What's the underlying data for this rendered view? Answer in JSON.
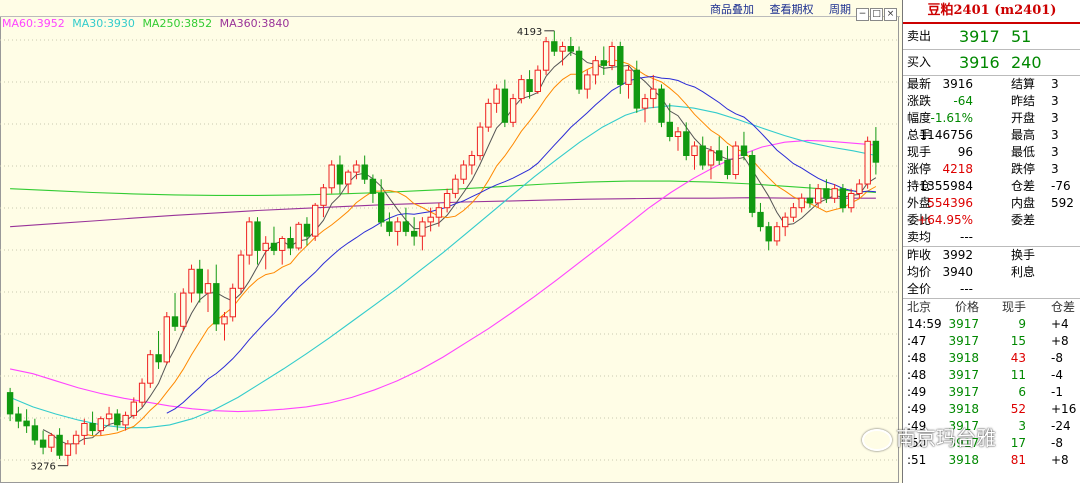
{
  "legend": [
    {
      "label": "MA60:3952",
      "color": "#ff44ff"
    },
    {
      "label": "MA30:3930",
      "color": "#33cccc"
    },
    {
      "label": "MA250:3852",
      "color": "#33cc33"
    },
    {
      "label": "MA360:3840",
      "color": "#993399"
    }
  ],
  "toolbar": [
    "商品叠加",
    "查看期权",
    "周期"
  ],
  "chart_labels": {
    "high": "4193",
    "low": "3276"
  },
  "quote": {
    "title": "豆粕2401 (m2401)",
    "sell": {
      "label": "卖出",
      "price": "3917",
      "vol": "51"
    },
    "buy": {
      "label": "买入",
      "price": "3916",
      "vol": "240"
    },
    "rows": [
      {
        "l1": "最新",
        "v1": "3916",
        "c1": "black",
        "l2": "结算",
        "v2": "3"
      },
      {
        "l1": "涨跌",
        "v1": "-64",
        "c1": "green",
        "l2": "昨结",
        "v2": "3"
      },
      {
        "l1": "幅度",
        "v1": "-1.61%",
        "c1": "green",
        "l2": "开盘",
        "v2": "3"
      },
      {
        "l1": "总手",
        "v1": "1146756",
        "c1": "black",
        "l2": "最高",
        "v2": "3"
      },
      {
        "l1": "现手",
        "v1": "96",
        "c1": "black",
        "l2": "最低",
        "v2": "3"
      },
      {
        "l1": "涨停",
        "v1": "4218",
        "c1": "red",
        "l2": "跌停",
        "v2": "3"
      },
      {
        "l1": "持仓",
        "v1": "1355984",
        "c1": "black",
        "l2": "仓差",
        "v2": "-76"
      },
      {
        "l1": "外盘",
        "v1": "554396",
        "c1": "red",
        "l2": "内盘",
        "v2": "592"
      },
      {
        "l1": "委比",
        "v1": "+64.95%",
        "c1": "red",
        "l2": "委差",
        "v2": ""
      }
    ],
    "avg": {
      "l1": "卖均",
      "v1": "---"
    },
    "rows2": [
      {
        "l1": "昨收",
        "v1": "3992",
        "c1": "black",
        "l2": "换手",
        "v2": ""
      },
      {
        "l1": "均价",
        "v1": "3940",
        "c1": "black",
        "l2": "利息",
        "v2": ""
      },
      {
        "l1": "全价",
        "v1": "---",
        "c1": "black",
        "l2": "",
        "v2": ""
      }
    ],
    "tick_header": [
      "北京",
      "价格",
      "现手",
      "仓差"
    ],
    "ticks": [
      {
        "time": "14:59",
        "price": "3917",
        "pc": "green",
        "vol": "9",
        "vc": "green",
        "oi": "+4"
      },
      {
        "time": ":47",
        "price": "3917",
        "pc": "green",
        "vol": "15",
        "vc": "green",
        "oi": "+8"
      },
      {
        "time": ":48",
        "price": "3918",
        "pc": "green",
        "vol": "43",
        "vc": "red",
        "oi": "-8"
      },
      {
        "time": ":48",
        "price": "3917",
        "pc": "green",
        "vol": "11",
        "vc": "green",
        "oi": "-4"
      },
      {
        "time": ":49",
        "price": "3917",
        "pc": "green",
        "vol": "6",
        "vc": "green",
        "oi": "-1"
      },
      {
        "time": ":49",
        "price": "3918",
        "pc": "green",
        "vol": "52",
        "vc": "red",
        "oi": "+16"
      },
      {
        "time": ":49",
        "price": "3917",
        "pc": "green",
        "vol": "3",
        "vc": "green",
        "oi": "-24"
      },
      {
        "time": ":50",
        "price": "3917",
        "pc": "green",
        "vol": "17",
        "vc": "green",
        "oi": "-8"
      },
      {
        "time": ":51",
        "price": "3918",
        "pc": "green",
        "vol": "81",
        "vc": "red",
        "oi": "+8"
      }
    ]
  },
  "watermark": "南京玛台雅",
  "chart_data": {
    "type": "candlestick",
    "y_unit": "price",
    "ylim": [
      3250,
      4220
    ],
    "ohlc": [
      [
        3430,
        3440,
        3370,
        3385
      ],
      [
        3385,
        3400,
        3355,
        3370
      ],
      [
        3370,
        3395,
        3345,
        3360
      ],
      [
        3360,
        3375,
        3320,
        3330
      ],
      [
        3330,
        3350,
        3300,
        3315
      ],
      [
        3315,
        3345,
        3305,
        3340
      ],
      [
        3340,
        3355,
        3290,
        3298
      ],
      [
        3298,
        3330,
        3276,
        3322
      ],
      [
        3322,
        3350,
        3300,
        3340
      ],
      [
        3340,
        3375,
        3320,
        3365
      ],
      [
        3365,
        3390,
        3340,
        3350
      ],
      [
        3350,
        3380,
        3340,
        3375
      ],
      [
        3375,
        3400,
        3360,
        3385
      ],
      [
        3385,
        3395,
        3350,
        3362
      ],
      [
        3362,
        3390,
        3350,
        3382
      ],
      [
        3382,
        3420,
        3375,
        3410
      ],
      [
        3410,
        3460,
        3400,
        3450
      ],
      [
        3450,
        3520,
        3440,
        3510
      ],
      [
        3510,
        3560,
        3480,
        3495
      ],
      [
        3495,
        3600,
        3490,
        3590
      ],
      [
        3590,
        3640,
        3560,
        3570
      ],
      [
        3570,
        3650,
        3560,
        3640
      ],
      [
        3640,
        3700,
        3620,
        3690
      ],
      [
        3690,
        3710,
        3620,
        3640
      ],
      [
        3640,
        3690,
        3600,
        3660
      ],
      [
        3660,
        3700,
        3560,
        3575
      ],
      [
        3575,
        3600,
        3540,
        3590
      ],
      [
        3590,
        3660,
        3580,
        3650
      ],
      [
        3650,
        3730,
        3640,
        3720
      ],
      [
        3720,
        3800,
        3700,
        3790
      ],
      [
        3790,
        3800,
        3700,
        3730
      ],
      [
        3730,
        3760,
        3690,
        3745
      ],
      [
        3745,
        3780,
        3720,
        3730
      ],
      [
        3730,
        3760,
        3700,
        3755
      ],
      [
        3755,
        3780,
        3720,
        3735
      ],
      [
        3735,
        3790,
        3730,
        3785
      ],
      [
        3785,
        3800,
        3740,
        3760
      ],
      [
        3760,
        3830,
        3750,
        3825
      ],
      [
        3825,
        3870,
        3800,
        3862
      ],
      [
        3862,
        3920,
        3850,
        3910
      ],
      [
        3910,
        3930,
        3850,
        3870
      ],
      [
        3870,
        3900,
        3850,
        3895
      ],
      [
        3895,
        3920,
        3880,
        3910
      ],
      [
        3910,
        3930,
        3870,
        3880
      ],
      [
        3880,
        3890,
        3830,
        3850
      ],
      [
        3850,
        3880,
        3780,
        3790
      ],
      [
        3790,
        3810,
        3760,
        3770
      ],
      [
        3770,
        3800,
        3740,
        3790
      ],
      [
        3790,
        3820,
        3760,
        3770
      ],
      [
        3770,
        3800,
        3740,
        3760
      ],
      [
        3760,
        3800,
        3730,
        3790
      ],
      [
        3790,
        3820,
        3770,
        3800
      ],
      [
        3800,
        3830,
        3780,
        3820
      ],
      [
        3820,
        3860,
        3810,
        3850
      ],
      [
        3850,
        3890,
        3840,
        3880
      ],
      [
        3880,
        3920,
        3870,
        3910
      ],
      [
        3910,
        3940,
        3890,
        3930
      ],
      [
        3930,
        4000,
        3920,
        3990
      ],
      [
        3990,
        4050,
        3980,
        4040
      ],
      [
        4040,
        4080,
        4020,
        4070
      ],
      [
        4070,
        4090,
        3990,
        4000
      ],
      [
        4000,
        4060,
        3990,
        4050
      ],
      [
        4050,
        4100,
        4040,
        4090
      ],
      [
        4090,
        4110,
        4050,
        4065
      ],
      [
        4065,
        4120,
        4060,
        4110
      ],
      [
        4110,
        4180,
        4100,
        4170
      ],
      [
        4170,
        4193,
        4140,
        4150
      ],
      [
        4150,
        4170,
        4120,
        4160
      ],
      [
        4160,
        4180,
        4140,
        4150
      ],
      [
        4150,
        4160,
        4060,
        4070
      ],
      [
        4070,
        4110,
        4050,
        4100
      ],
      [
        4100,
        4140,
        4080,
        4130
      ],
      [
        4130,
        4160,
        4100,
        4120
      ],
      [
        4120,
        4170,
        4110,
        4160
      ],
      [
        4160,
        4170,
        4060,
        4080
      ],
      [
        4080,
        4120,
        4050,
        4110
      ],
      [
        4110,
        4130,
        4020,
        4030
      ],
      [
        4030,
        4060,
        4000,
        4050
      ],
      [
        4050,
        4100,
        4030,
        4070
      ],
      [
        4070,
        4080,
        3990,
        4000
      ],
      [
        4000,
        4040,
        3960,
        3970
      ],
      [
        3970,
        3990,
        3940,
        3980
      ],
      [
        3980,
        4000,
        3920,
        3930
      ],
      [
        3930,
        3960,
        3900,
        3950
      ],
      [
        3950,
        3970,
        3900,
        3910
      ],
      [
        3910,
        3950,
        3880,
        3940
      ],
      [
        3940,
        3970,
        3910,
        3920
      ],
      [
        3920,
        3950,
        3880,
        3890
      ],
      [
        3890,
        3960,
        3880,
        3950
      ],
      [
        3950,
        3980,
        3920,
        3930
      ],
      [
        3930,
        3940,
        3800,
        3810
      ],
      [
        3810,
        3830,
        3770,
        3780
      ],
      [
        3780,
        3790,
        3730,
        3750
      ],
      [
        3750,
        3790,
        3740,
        3780
      ],
      [
        3780,
        3810,
        3760,
        3800
      ],
      [
        3800,
        3830,
        3790,
        3820
      ],
      [
        3820,
        3850,
        3810,
        3840
      ],
      [
        3840,
        3870,
        3820,
        3830
      ],
      [
        3830,
        3870,
        3820,
        3860
      ],
      [
        3860,
        3880,
        3830,
        3840
      ],
      [
        3840,
        3870,
        3830,
        3860
      ],
      [
        3860,
        3870,
        3810,
        3820
      ],
      [
        3820,
        3860,
        3810,
        3850
      ],
      [
        3850,
        3880,
        3840,
        3870
      ],
      [
        3870,
        3970,
        3860,
        3960
      ],
      [
        3960,
        3990,
        3890,
        3916
      ]
    ],
    "ma": [
      {
        "name": "MA60",
        "value": 3952,
        "color": "#ff44ff",
        "points": [
          3480,
          3470,
          3455,
          3440,
          3428,
          3418,
          3410,
          3402,
          3396,
          3392,
          3390,
          3392,
          3395,
          3400,
          3408,
          3420,
          3436,
          3455,
          3478,
          3505,
          3535,
          3565,
          3598,
          3632,
          3668,
          3705,
          3742,
          3780,
          3818,
          3852,
          3882,
          3908,
          3930,
          3948,
          3958,
          3962,
          3960,
          3956,
          3952
        ]
      },
      {
        "name": "MA30",
        "value": 3930,
        "color": "#33cccc",
        "points": [
          3420,
          3400,
          3385,
          3372,
          3362,
          3356,
          3356,
          3362,
          3375,
          3395,
          3420,
          3450,
          3480,
          3512,
          3545,
          3580,
          3615,
          3650,
          3688,
          3725,
          3765,
          3805,
          3845,
          3885,
          3922,
          3958,
          3990,
          4015,
          4030,
          4035,
          4030,
          4020,
          4005,
          3988,
          3972,
          3958,
          3948,
          3940,
          3930
        ]
      },
      {
        "name": "MA250",
        "value": 3852,
        "color": "#33cc33",
        "points": [
          3860,
          3856,
          3852,
          3849,
          3847,
          3846,
          3846,
          3847,
          3849,
          3852,
          3856,
          3860,
          3865,
          3870,
          3874,
          3876,
          3876,
          3874,
          3870,
          3864,
          3858,
          3852
        ]
      },
      {
        "name": "MA360",
        "value": 3840,
        "color": "#993399",
        "points": [
          3780,
          3786,
          3792,
          3798,
          3804,
          3809,
          3814,
          3818,
          3822,
          3826,
          3829,
          3832,
          3834,
          3836,
          3838,
          3839,
          3840,
          3840,
          3841,
          3840,
          3840,
          3840
        ]
      }
    ]
  }
}
